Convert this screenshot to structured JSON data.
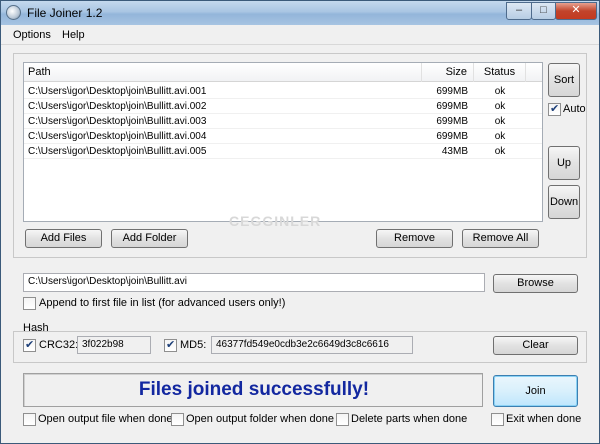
{
  "window": {
    "title": "File Joiner 1.2",
    "minimize": "–",
    "maximize": "□",
    "close": "✕"
  },
  "menu": {
    "items": [
      "Options",
      "Help"
    ]
  },
  "file_list": {
    "columns": [
      "Path",
      "Size",
      "Status"
    ],
    "rows": [
      {
        "path": "C:\\Users\\igor\\Desktop\\join\\Bullitt.avi.001",
        "size": "699MB",
        "status": "ok"
      },
      {
        "path": "C:\\Users\\igor\\Desktop\\join\\Bullitt.avi.002",
        "size": "699MB",
        "status": "ok"
      },
      {
        "path": "C:\\Users\\igor\\Desktop\\join\\Bullitt.avi.003",
        "size": "699MB",
        "status": "ok"
      },
      {
        "path": "C:\\Users\\igor\\Desktop\\join\\Bullitt.avi.004",
        "size": "699MB",
        "status": "ok"
      },
      {
        "path": "C:\\Users\\igor\\Desktop\\join\\Bullitt.avi.005",
        "size": "43MB",
        "status": "ok"
      }
    ]
  },
  "side_buttons": {
    "sort": "Sort",
    "auto": "Auto",
    "auto_checked": true,
    "up": "Up",
    "down": "Down"
  },
  "list_buttons": {
    "add_files": "Add Files",
    "add_folder": "Add Folder",
    "remove": "Remove",
    "remove_all": "Remove All"
  },
  "output": {
    "path": "C:\\Users\\igor\\Desktop\\join\\Bullitt.avi",
    "browse": "Browse",
    "append_label": "Append to first file in list (for advanced users only!)",
    "append_checked": false
  },
  "hash": {
    "group_label": "Hash",
    "crc32_label": "CRC32:",
    "crc32_checked": true,
    "crc32_value": "3f022b98",
    "md5_label": "MD5:",
    "md5_checked": true,
    "md5_value": "46377fd549e0cdb3e2c6649d3c8c6616",
    "clear": "Clear"
  },
  "status": {
    "message": "Files joined successfully!",
    "join": "Join"
  },
  "options": {
    "open_file": "Open output file when done",
    "open_folder": "Open output folder when done",
    "delete_parts": "Delete parts when done",
    "exit": "Exit when done"
  },
  "colors": {
    "status_text": "#1328a0",
    "titlebar": "#a9c5e3"
  },
  "watermark": "CEGGINLER"
}
